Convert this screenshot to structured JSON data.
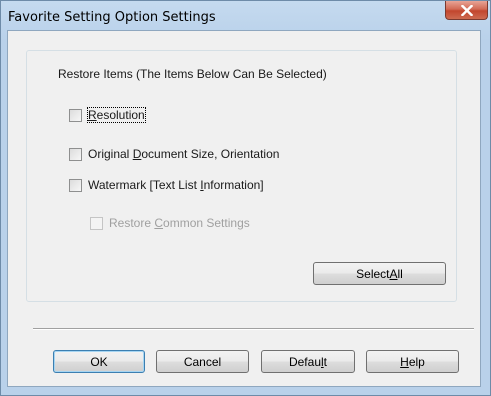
{
  "window": {
    "title": "Favorite Setting Option Settings"
  },
  "group": {
    "legend": "Restore Items (The Items Below Can Be Selected)"
  },
  "checkboxes": [
    {
      "pre": "",
      "key": "R",
      "post": "esolution",
      "checked": false,
      "enabled": true
    },
    {
      "pre": "Original ",
      "key": "D",
      "post": "ocument Size, Orientation",
      "checked": false,
      "enabled": true
    },
    {
      "pre": "Watermark [Text List ",
      "key": "I",
      "post": "nformation]",
      "checked": false,
      "enabled": true
    },
    {
      "pre": "Restore ",
      "key": "C",
      "post": "ommon Settings",
      "checked": false,
      "enabled": false
    }
  ],
  "select_all": {
    "pre": "Select ",
    "key": "A",
    "post": "ll"
  },
  "buttons": {
    "ok": "OK",
    "cancel": "Cancel",
    "default": {
      "pre": "Defau",
      "key": "l",
      "post": "t"
    },
    "help": {
      "pre": "",
      "key": "H",
      "post": "elp"
    }
  },
  "colors": {
    "close_button": "#c2462e",
    "default_button_border": "#3c7fb1"
  },
  "icons": {
    "close": "close-x-icon"
  }
}
